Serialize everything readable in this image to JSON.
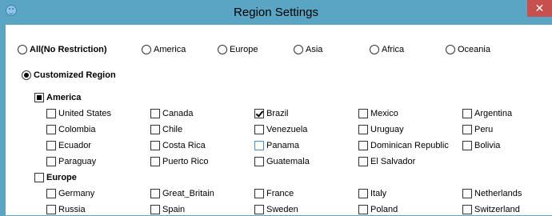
{
  "window": {
    "title": "Region Settings",
    "close_glyph": "✕"
  },
  "top_radios": [
    {
      "label": "All(No Restriction)",
      "checked": false,
      "bold": true
    },
    {
      "label": "America",
      "checked": false
    },
    {
      "label": "Europe",
      "checked": false
    },
    {
      "label": "Asia",
      "checked": false
    },
    {
      "label": "Africa",
      "checked": false
    },
    {
      "label": "Oceania",
      "checked": false
    }
  ],
  "customized": {
    "label": "Customized Region",
    "checked": true
  },
  "groups": [
    {
      "label": "America",
      "state": "indeterminate",
      "countries": [
        [
          "United States",
          "Canada",
          "Brazil",
          "Mexico",
          "Argentina"
        ],
        [
          "Colombia",
          "Chile",
          "Venezuela",
          "Uruguay",
          "Peru"
        ],
        [
          "Ecuador",
          "Costa Rica",
          "Panama",
          "Dominican Republic",
          "Bolivia"
        ],
        [
          "Paraguay",
          "Puerto Rico",
          "Guatemala",
          "El Salvador"
        ]
      ],
      "checked": [
        "Brazil"
      ],
      "focused": [
        "Panama"
      ]
    },
    {
      "label": "Europe",
      "state": "unchecked",
      "countries": [
        [
          "Germany",
          "Great_Britain",
          "France",
          "Italy",
          "Netherlands"
        ],
        [
          "Russia",
          "Spain",
          "Sweden",
          "Poland",
          "Switzerland"
        ]
      ],
      "checked": [],
      "focused": []
    }
  ]
}
